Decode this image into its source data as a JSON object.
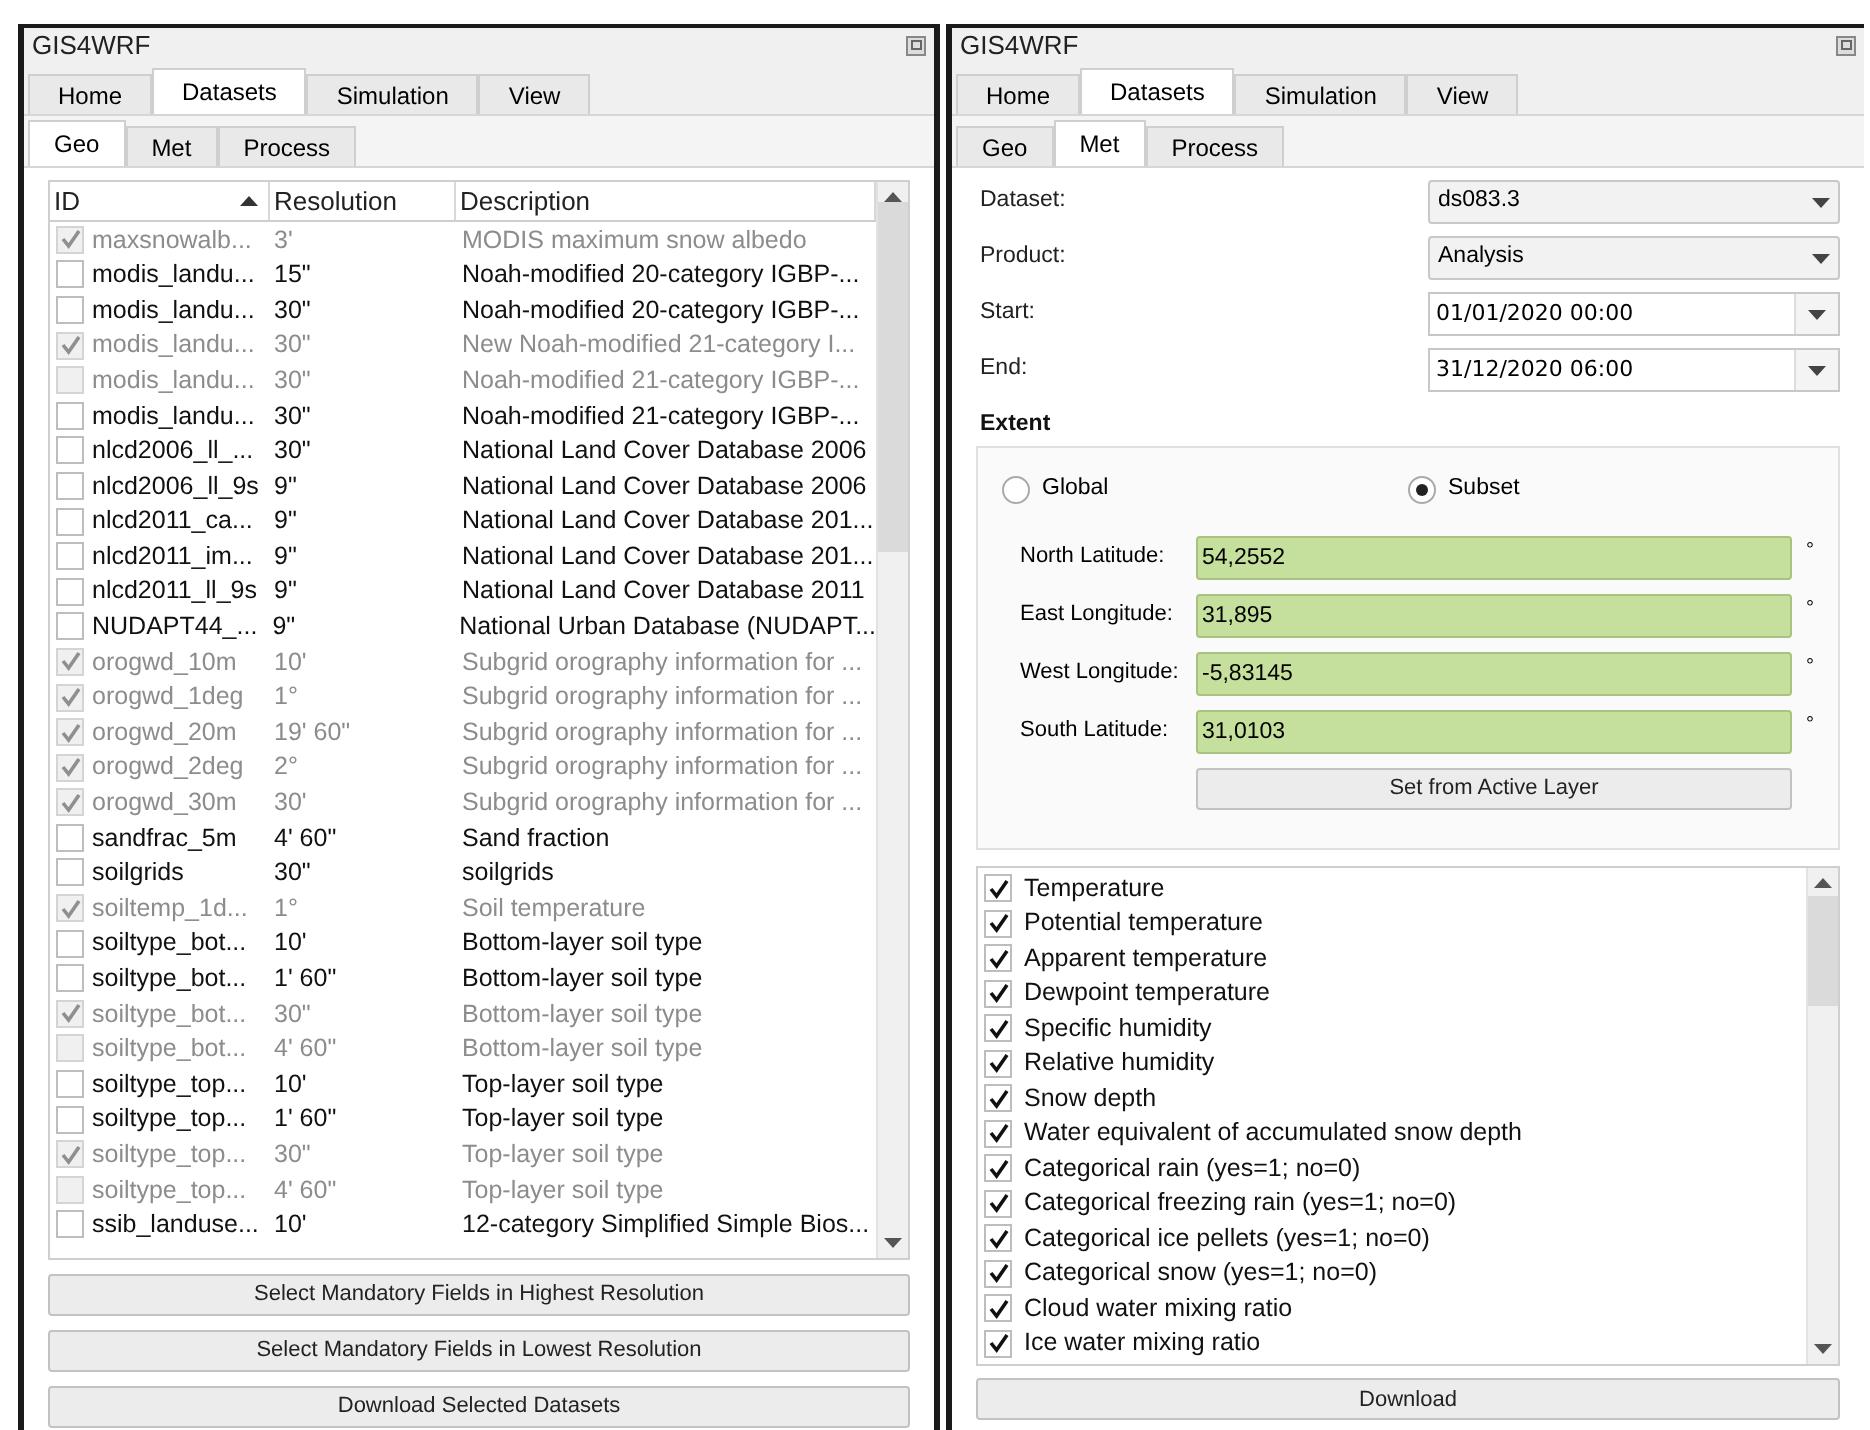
{
  "left_panel": {
    "window_title": "GIS4WRF",
    "tabs": [
      {
        "label": "Home",
        "selected": false
      },
      {
        "label": "Datasets",
        "selected": true
      },
      {
        "label": "Simulation",
        "selected": false
      },
      {
        "label": "View",
        "selected": false
      }
    ],
    "subtabs": [
      {
        "label": "Geo",
        "selected": true
      },
      {
        "label": "Met",
        "selected": false
      },
      {
        "label": "Process",
        "selected": false
      }
    ],
    "table": {
      "columns": [
        {
          "label": "ID",
          "sorted": true
        },
        {
          "label": "Resolution",
          "sorted": false
        },
        {
          "label": "Description",
          "sorted": false
        }
      ],
      "rows": [
        {
          "id": "maxsnowalb...",
          "resolution": "3'",
          "description": "MODIS maximum snow albedo",
          "checked": true,
          "disabled": true
        },
        {
          "id": "modis_landu...",
          "resolution": "15\"",
          "description": "Noah-modified 20-category IGBP-...",
          "checked": false,
          "disabled": false
        },
        {
          "id": "modis_landu...",
          "resolution": "30\"",
          "description": "Noah-modified 20-category IGBP-...",
          "checked": false,
          "disabled": false
        },
        {
          "id": "modis_landu...",
          "resolution": "30\"",
          "description": "New Noah-modified 21-category I...",
          "checked": true,
          "disabled": true
        },
        {
          "id": "modis_landu...",
          "resolution": "30\"",
          "description": "Noah-modified 21-category IGBP-...",
          "checked": false,
          "disabled": true
        },
        {
          "id": "modis_landu...",
          "resolution": "30\"",
          "description": "Noah-modified 21-category IGBP-...",
          "checked": false,
          "disabled": false
        },
        {
          "id": "nlcd2006_ll_...",
          "resolution": "30\"",
          "description": "National Land Cover Database 2006",
          "checked": false,
          "disabled": false
        },
        {
          "id": "nlcd2006_ll_9s",
          "resolution": "9\"",
          "description": "National Land Cover Database 2006",
          "checked": false,
          "disabled": false
        },
        {
          "id": "nlcd2011_ca...",
          "resolution": "9\"",
          "description": "National Land Cover Database 201...",
          "checked": false,
          "disabled": false
        },
        {
          "id": "nlcd2011_im...",
          "resolution": "9\"",
          "description": "National Land Cover Database 201...",
          "checked": false,
          "disabled": false
        },
        {
          "id": "nlcd2011_ll_9s",
          "resolution": "9\"",
          "description": "National Land Cover Database 2011",
          "checked": false,
          "disabled": false
        },
        {
          "id": "NUDAPT44_...",
          "resolution": "9\"",
          "description": "National Urban Database (NUDAPT...",
          "checked": false,
          "disabled": false
        },
        {
          "id": "orogwd_10m",
          "resolution": "10'",
          "description": "Subgrid orography information for ...",
          "checked": true,
          "disabled": true
        },
        {
          "id": "orogwd_1deg",
          "resolution": "1°",
          "description": "Subgrid orography information for ...",
          "checked": true,
          "disabled": true
        },
        {
          "id": "orogwd_20m",
          "resolution": "19' 60\"",
          "description": "Subgrid orography information for ...",
          "checked": true,
          "disabled": true
        },
        {
          "id": "orogwd_2deg",
          "resolution": "2°",
          "description": "Subgrid orography information for ...",
          "checked": true,
          "disabled": true
        },
        {
          "id": "orogwd_30m",
          "resolution": "30'",
          "description": "Subgrid orography information for ...",
          "checked": true,
          "disabled": true
        },
        {
          "id": "sandfrac_5m",
          "resolution": "4' 60\"",
          "description": "Sand fraction",
          "checked": false,
          "disabled": false
        },
        {
          "id": "soilgrids",
          "resolution": "30\"",
          "description": "soilgrids",
          "checked": false,
          "disabled": false
        },
        {
          "id": "soiltemp_1d...",
          "resolution": "1°",
          "description": "Soil temperature",
          "checked": true,
          "disabled": true
        },
        {
          "id": "soiltype_bot...",
          "resolution": "10'",
          "description": "Bottom-layer soil type",
          "checked": false,
          "disabled": false
        },
        {
          "id": "soiltype_bot...",
          "resolution": "1' 60\"",
          "description": "Bottom-layer soil type",
          "checked": false,
          "disabled": false
        },
        {
          "id": "soiltype_bot...",
          "resolution": "30\"",
          "description": "Bottom-layer soil type",
          "checked": true,
          "disabled": true
        },
        {
          "id": "soiltype_bot...",
          "resolution": "4' 60\"",
          "description": "Bottom-layer soil type",
          "checked": false,
          "disabled": true
        },
        {
          "id": "soiltype_top...",
          "resolution": "10'",
          "description": "Top-layer soil type",
          "checked": false,
          "disabled": false
        },
        {
          "id": "soiltype_top...",
          "resolution": "1' 60\"",
          "description": "Top-layer soil type",
          "checked": false,
          "disabled": false
        },
        {
          "id": "soiltype_top...",
          "resolution": "30\"",
          "description": "Top-layer soil type",
          "checked": true,
          "disabled": true
        },
        {
          "id": "soiltype_top...",
          "resolution": "4' 60\"",
          "description": "Top-layer soil type",
          "checked": false,
          "disabled": true
        },
        {
          "id": "ssib_landuse...",
          "resolution": "10'",
          "description": "12-category Simplified Simple Bios...",
          "checked": false,
          "disabled": false
        }
      ]
    },
    "buttons": [
      "Select Mandatory Fields in Highest Resolution",
      "Select Mandatory Fields in Lowest Resolution",
      "Download Selected Datasets"
    ]
  },
  "right_panel": {
    "window_title": "GIS4WRF",
    "tabs": [
      {
        "label": "Home",
        "selected": false
      },
      {
        "label": "Datasets",
        "selected": true
      },
      {
        "label": "Simulation",
        "selected": false
      },
      {
        "label": "View",
        "selected": false
      }
    ],
    "subtabs": [
      {
        "label": "Geo",
        "selected": false
      },
      {
        "label": "Met",
        "selected": true
      },
      {
        "label": "Process",
        "selected": false
      }
    ],
    "fields": [
      {
        "label": "Dataset:",
        "value": "ds083.3",
        "kind": "dropdown"
      },
      {
        "label": "Product:",
        "value": "Analysis",
        "kind": "dropdown"
      },
      {
        "label": "Start:",
        "value": "01/01/2020 00:00",
        "kind": "datetime"
      },
      {
        "label": "End:",
        "value": "31/12/2020 06:00",
        "kind": "datetime"
      }
    ],
    "extent": {
      "title": "Extent",
      "options": [
        {
          "label": "Global",
          "selected": false
        },
        {
          "label": "Subset",
          "selected": true
        }
      ],
      "coordinates": [
        {
          "label": "North Latitude:",
          "value": "54,2552",
          "unit": "°"
        },
        {
          "label": "East Longitude:",
          "value": "31,895",
          "unit": "°"
        },
        {
          "label": "West Longitude:",
          "value": "-5,83145",
          "unit": "°"
        },
        {
          "label": "South Latitude:",
          "value": "31,0103",
          "unit": "°"
        }
      ],
      "button": "Set from Active Layer"
    },
    "variables": [
      {
        "label": "Temperature",
        "checked": true
      },
      {
        "label": "Potential temperature",
        "checked": true
      },
      {
        "label": "Apparent temperature",
        "checked": true
      },
      {
        "label": "Dewpoint temperature",
        "checked": true
      },
      {
        "label": "Specific humidity",
        "checked": true
      },
      {
        "label": "Relative humidity",
        "checked": true
      },
      {
        "label": "Snow depth",
        "checked": true
      },
      {
        "label": "Water equivalent of accumulated snow depth",
        "checked": true
      },
      {
        "label": "Categorical rain (yes=1; no=0)",
        "checked": true
      },
      {
        "label": "Categorical freezing rain (yes=1; no=0)",
        "checked": true
      },
      {
        "label": "Categorical ice pellets (yes=1; no=0)",
        "checked": true
      },
      {
        "label": "Categorical snow (yes=1; no=0)",
        "checked": true
      },
      {
        "label": "Cloud water mixing ratio",
        "checked": true
      },
      {
        "label": "Ice water mixing ratio",
        "checked": true
      }
    ],
    "download_button": "Download"
  }
}
